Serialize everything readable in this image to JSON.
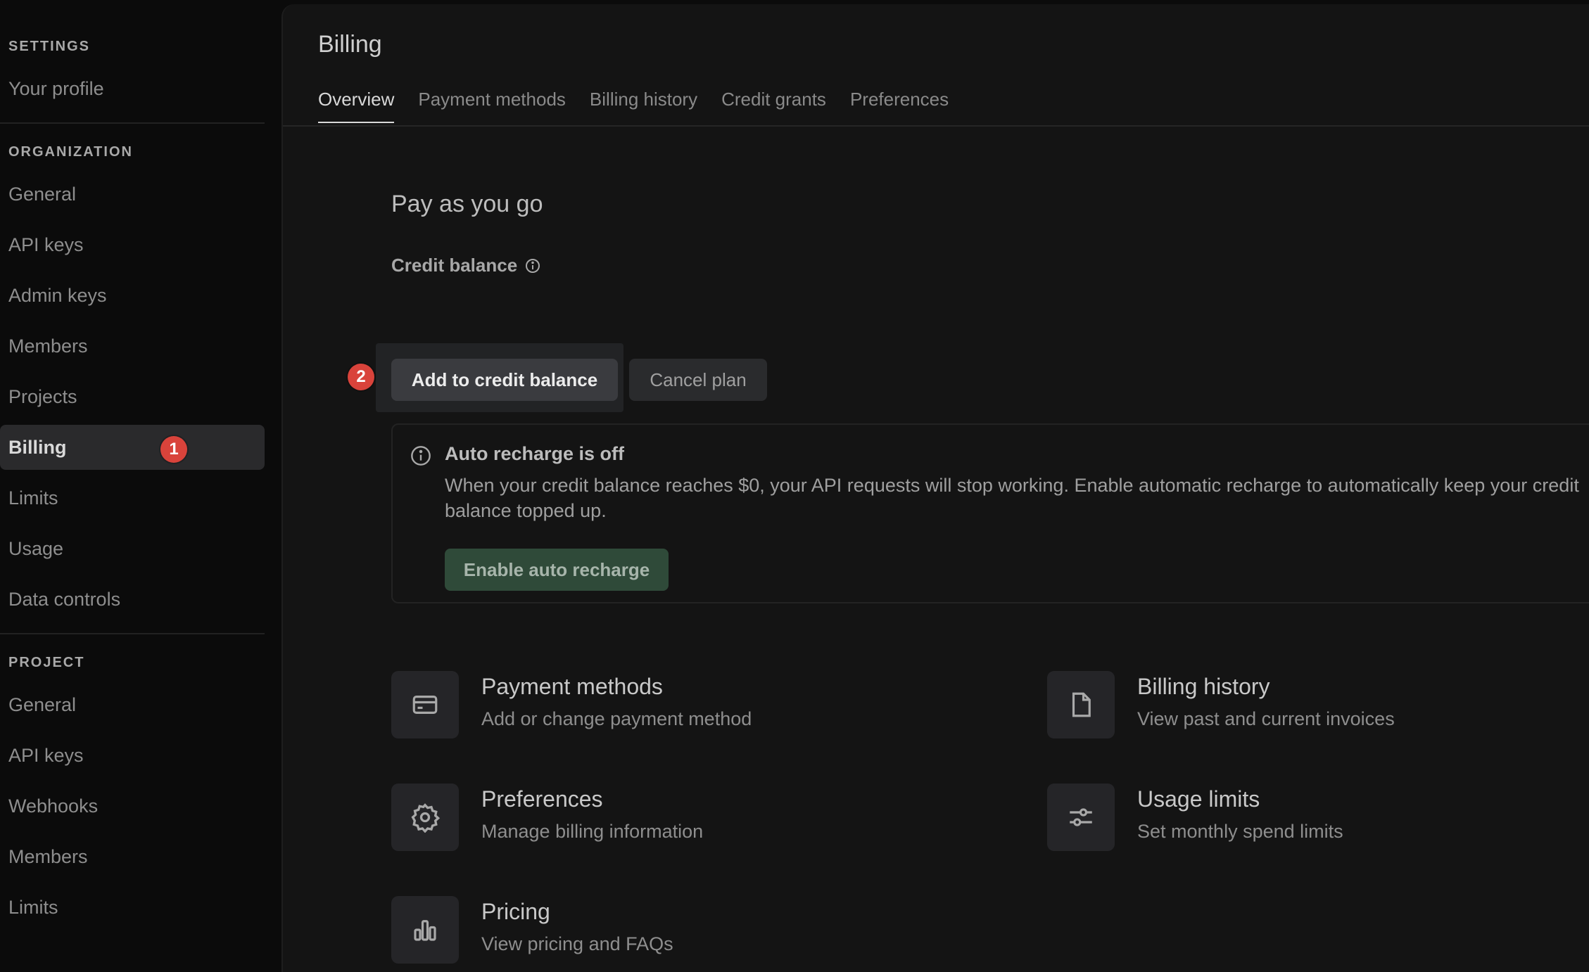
{
  "sidebar": {
    "settings_title": "SETTINGS",
    "settings_items": [
      "Your profile"
    ],
    "organization_title": "ORGANIZATION",
    "organization_items": [
      "General",
      "API keys",
      "Admin keys",
      "Members",
      "Projects",
      "Billing",
      "Limits",
      "Usage",
      "Data controls"
    ],
    "project_title": "PROJECT",
    "project_items": [
      "General",
      "API keys",
      "Webhooks",
      "Members",
      "Limits"
    ],
    "active_item": "Billing"
  },
  "badges": {
    "billing_badge": "1",
    "add_credit_badge": "2"
  },
  "page": {
    "title": "Billing",
    "tabs": [
      "Overview",
      "Payment methods",
      "Billing history",
      "Credit grants",
      "Preferences"
    ],
    "active_tab": "Overview"
  },
  "plan": {
    "title": "Pay as you go",
    "credit_balance_label": "Credit balance",
    "add_credit_button": "Add to credit balance",
    "cancel_plan_button": "Cancel plan"
  },
  "notice": {
    "title": "Auto recharge is off",
    "text": "When your credit balance reaches $0, your API requests will stop working. Enable automatic recharge to automatically keep your credit balance topped up.",
    "button": "Enable auto recharge"
  },
  "cards": {
    "payment_methods": {
      "title": "Payment methods",
      "subtitle": "Add or change payment method",
      "icon": "credit-card-icon"
    },
    "billing_history": {
      "title": "Billing history",
      "subtitle": "View past and current invoices",
      "icon": "document-icon"
    },
    "preferences": {
      "title": "Preferences",
      "subtitle": "Manage billing information",
      "icon": "gear-icon"
    },
    "usage_limits": {
      "title": "Usage limits",
      "subtitle": "Set monthly spend limits",
      "icon": "sliders-icon"
    },
    "pricing": {
      "title": "Pricing",
      "subtitle": "View pricing and FAQs",
      "icon": "bar-chart-icon"
    }
  },
  "colors": {
    "background": "#0b0b0b",
    "panel": "#141414",
    "badge": "#d9433b",
    "recharge_button": "#2f4a39"
  }
}
